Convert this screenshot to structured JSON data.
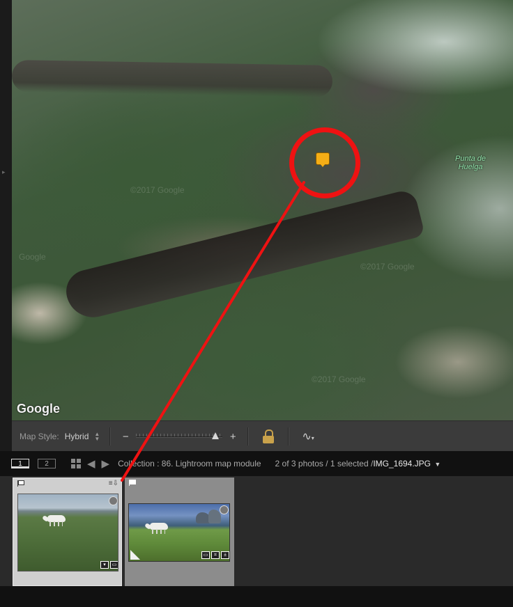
{
  "map": {
    "google_logo": "Google",
    "place_label_line1": "Punta de",
    "place_label_line2": "Huelga",
    "watermark_1": "©2017 Google",
    "watermark_2": "©2017 Google",
    "watermark_3": "Google",
    "watermark_4": "©2017 Google"
  },
  "toolbar": {
    "map_style_label": "Map Style:",
    "map_style_value": "Hybrid",
    "zoom_minus": "−",
    "zoom_plus": "+",
    "zoom_level_fraction": 0.92
  },
  "filmstrip_header": {
    "screen_1": "1",
    "screen_2": "2",
    "breadcrumb": "Collection : 86. Lightroom map module",
    "photo_count": "2 of 3 photos / 1 selected /",
    "current_file": "IMG_1694.JPG"
  },
  "colors": {
    "annotation": "#ef1212",
    "pin": "#f5ae16",
    "toolbar_bg": "#3b3b3b",
    "filmstrip_bg": "#2a2a2a"
  }
}
